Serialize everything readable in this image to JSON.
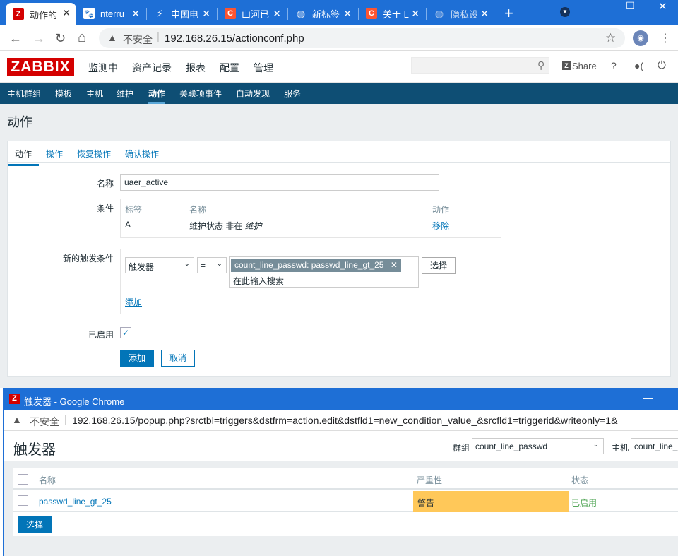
{
  "browser": {
    "tabs": [
      {
        "label": "动作的",
        "icon": "zabbix-icon",
        "active": true
      },
      {
        "label": "nterru",
        "icon": "paw-icon"
      },
      {
        "label": "中国电",
        "icon": "telecom-icon"
      },
      {
        "label": "山河已",
        "icon": "csdn-icon"
      },
      {
        "label": "新标签",
        "icon": "globe-icon"
      },
      {
        "label": "关于 L",
        "icon": "csdn-icon"
      },
      {
        "label": "隐私设",
        "icon": "globe-icon"
      }
    ],
    "new_tab": "+",
    "security": "不安全",
    "url": "192.168.26.15/actionconf.php"
  },
  "zabbix": {
    "logo": "ZABBIX",
    "top_menu": [
      "监测中",
      "资产记录",
      "报表",
      "配置",
      "管理"
    ],
    "share": "Share",
    "help": "?",
    "sub_menu": [
      "主机群组",
      "模板",
      "主机",
      "维护",
      "动作",
      "关联项事件",
      "自动发现",
      "服务"
    ],
    "page_title": "动作"
  },
  "form": {
    "tabs": [
      "动作",
      "操作",
      "恢复操作",
      "确认操作"
    ],
    "name_label": "名称",
    "name_value": "uaer_active",
    "conditions_label": "条件",
    "conditions_headers": [
      "标签",
      "名称",
      "动作"
    ],
    "conditions_rows": [
      {
        "tag": "A",
        "name_prefix": "维护状态 非在 ",
        "name_emph": "维护",
        "action": "移除"
      }
    ],
    "new_condition_label": "新的触发条件",
    "condition_type": "触发器",
    "operator": "=",
    "selected_chip": "count_line_passwd: passwd_line_gt_25",
    "search_placeholder": "在此输入搜索",
    "select_button": "选择",
    "add_link": "添加",
    "enabled_label": "已启用",
    "add_button": "添加",
    "cancel_button": "取消"
  },
  "popup": {
    "window_title": "触发器 - Google Chrome",
    "security": "不安全",
    "url": "192.168.26.15/popup.php?srctbl=triggers&dstfrm=action.edit&dstfld1=new_condition_value_&srcfld1=triggerid&writeonly=1&",
    "heading": "触发器",
    "group_label": "群组",
    "group_value": "count_line_passwd",
    "host_label": "主机",
    "host_value": "count_line_",
    "table_headers": [
      "名称",
      "严重性",
      "状态"
    ],
    "rows": [
      {
        "name": "passwd_line_gt_25",
        "severity": "警告",
        "status": "已启用"
      }
    ],
    "select_button": "选择",
    "colors": {
      "warning": "#ffc859",
      "enabled": "#429e47"
    }
  }
}
